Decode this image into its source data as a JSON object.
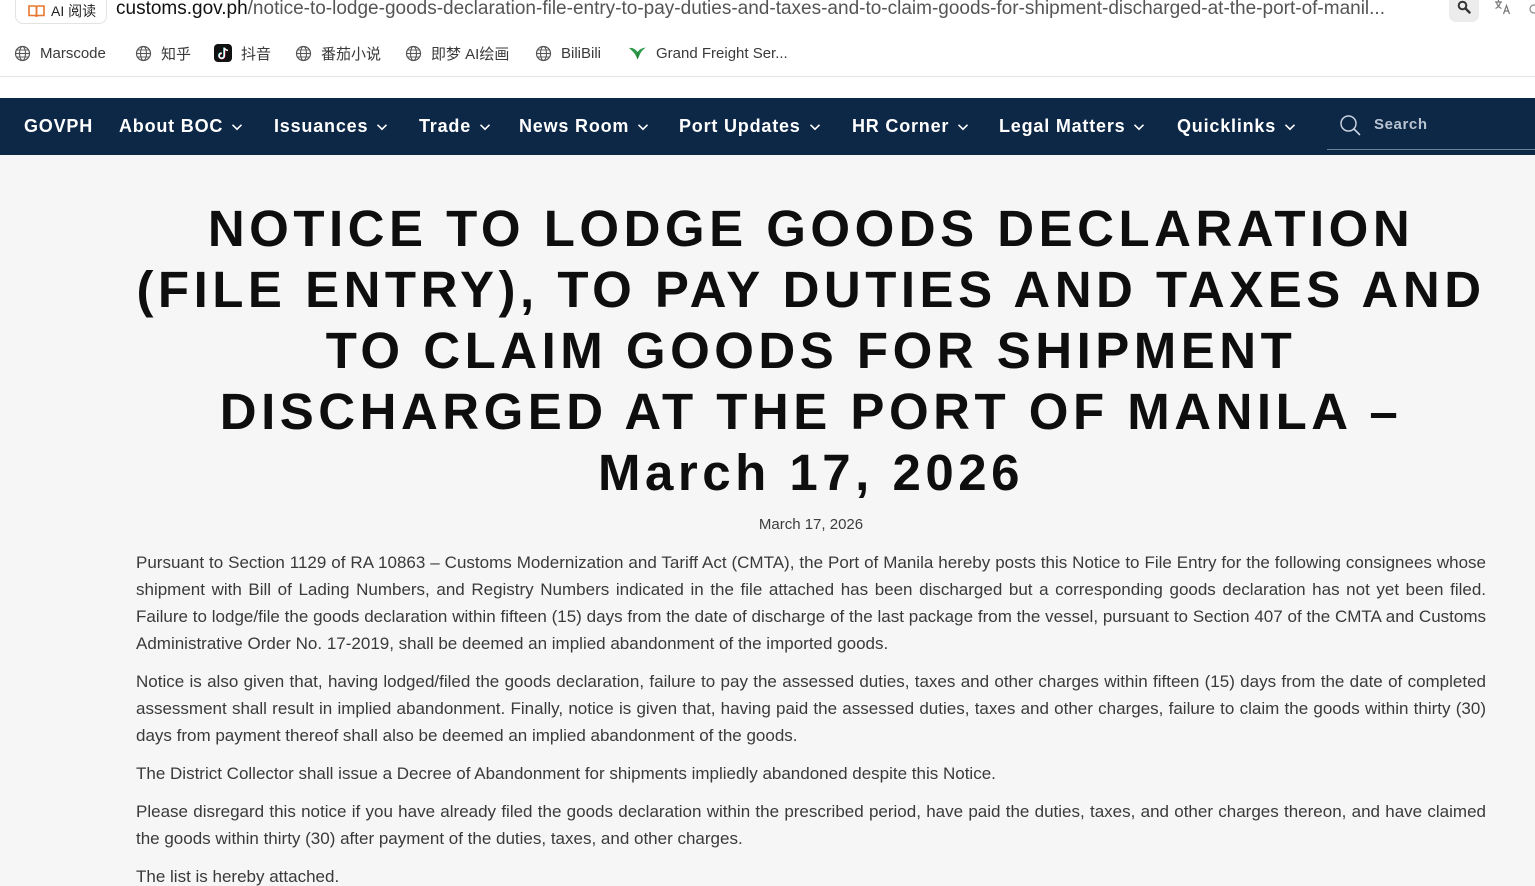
{
  "browser": {
    "ai_read_label": "AI 阅读",
    "url_host": "customs.gov.ph",
    "url_path": "/notice-to-lodge-goods-declaration-file-entry-to-pay-duties-and-taxes-and-to-claim-goods-for-shipment-discharged-at-the-port-of-manil...",
    "icons": [
      "ai-read-icon",
      "zoom-icon",
      "translate-icon"
    ]
  },
  "bookmarks": [
    {
      "label": "Marscode",
      "icon": "globe-icon"
    },
    {
      "label": "知乎",
      "icon": "globe-icon"
    },
    {
      "label": "抖音",
      "icon": "tiktok-icon"
    },
    {
      "label": "番茄小说",
      "icon": "globe-icon"
    },
    {
      "label": "即梦 AI绘画",
      "icon": "globe-icon"
    },
    {
      "label": "BiliBili",
      "icon": "globe-icon"
    },
    {
      "label": "Grand Freight Ser...",
      "icon": "bird-logo-icon"
    }
  ],
  "nav": {
    "brand": "GOVPH",
    "items": [
      {
        "label": "About BOC"
      },
      {
        "label": "Issuances"
      },
      {
        "label": "Trade"
      },
      {
        "label": "News Room"
      },
      {
        "label": "Port Updates"
      },
      {
        "label": "HR Corner"
      },
      {
        "label": "Legal Matters"
      },
      {
        "label": "Quicklinks"
      }
    ],
    "search_placeholder": "Search"
  },
  "article": {
    "title": "NOTICE TO LODGE GOODS DECLARATION (FILE ENTRY), TO PAY DUTIES AND TAXES AND TO CLAIM GOODS FOR SHIPMENT DISCHARGED AT THE PORT OF MANILA – March 17, 2026",
    "date": "March 17, 2026",
    "paragraphs": [
      "Pursuant to Section 1129 of RA 10863 – Customs Modernization and Tariff Act (CMTA), the Port of Manila hereby posts this Notice to File Entry for the following consignees whose shipment with Bill of Lading Numbers, and Registry Numbers indicated in the file attached has been discharged but a corresponding goods declaration has not yet been filed. Failure to lodge/file the goods declaration within fifteen (15) days from the date of discharge of the last package from the vessel, pursuant to Section 407 of the CMTA and Customs Administrative Order No. 17-2019, shall be deemed an implied abandonment of the imported goods.",
      "Notice is also given that, having lodged/filed the goods declaration, failure to pay the assessed duties, taxes and other charges within fifteen (15) days from the date of completed assessment shall result in implied abandonment. Finally, notice is given that, having paid the assessed duties, taxes and other charges, failure to claim the goods within thirty (30) days from payment thereof shall also be deemed an implied abandonment of the goods.",
      "The District Collector shall issue a Decree of Abandonment for shipments impliedly abandoned despite this Notice.",
      "Please disregard this notice if you have already filed the goods declaration within the prescribed period, have paid the duties, taxes, and other charges thereon, and have claimed the goods within thirty (30) after payment of the duties, taxes, and other charges.",
      "The list is hereby attached."
    ]
  },
  "colors": {
    "nav_background": "#0d2747",
    "nav_text": "#ffffff",
    "page_background": "#f6f6f6",
    "ai_icon": "#e8772e"
  }
}
